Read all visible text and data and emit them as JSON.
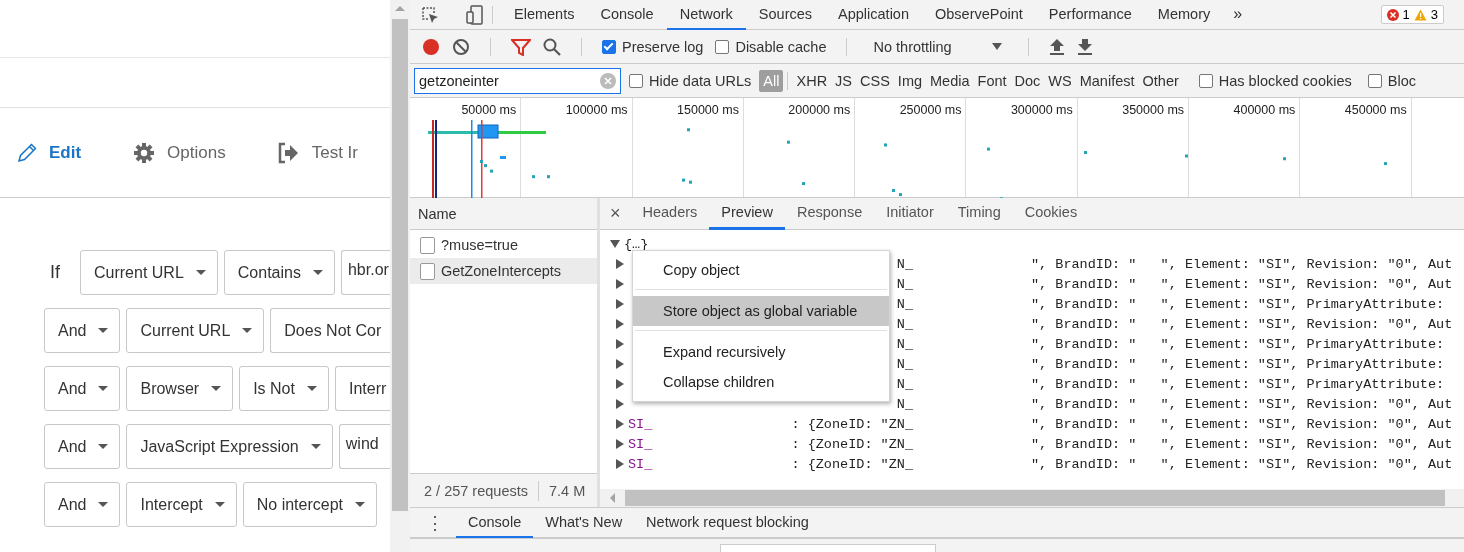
{
  "app": {
    "nav": [
      {
        "label": "Edit",
        "selected": true
      },
      {
        "label": "Options",
        "selected": false
      },
      {
        "label": "Test Ir",
        "selected": false
      }
    ],
    "rules": [
      {
        "lead": "If",
        "items": [
          {
            "label": "Current URL",
            "kind": "dropdown"
          },
          {
            "label": "Contains",
            "kind": "dropdown"
          },
          {
            "label": "hbr.or",
            "kind": "field",
            "cut": true
          }
        ]
      },
      {
        "items": [
          {
            "label": "And",
            "kind": "dropdown"
          },
          {
            "label": "Current URL",
            "kind": "dropdown"
          },
          {
            "label": "Does Not Cor",
            "kind": "dropdown",
            "cut": true
          }
        ]
      },
      {
        "items": [
          {
            "label": "And",
            "kind": "dropdown"
          },
          {
            "label": "Browser",
            "kind": "dropdown"
          },
          {
            "label": "Is Not",
            "kind": "dropdown"
          },
          {
            "label": "Interr",
            "kind": "dropdown",
            "cut": true
          }
        ]
      },
      {
        "items": [
          {
            "label": "And",
            "kind": "dropdown"
          },
          {
            "label": "JavaScript Expression",
            "kind": "dropdown"
          },
          {
            "label": "wind",
            "kind": "field",
            "cut": true
          }
        ]
      },
      {
        "items": [
          {
            "label": "And",
            "kind": "dropdown"
          },
          {
            "label": "Intercept",
            "kind": "dropdown"
          },
          {
            "label": "No intercept",
            "kind": "dropdown"
          }
        ]
      }
    ]
  },
  "devtools": {
    "tabs": [
      {
        "label": "Elements",
        "selected": false
      },
      {
        "label": "Console",
        "selected": false
      },
      {
        "label": "Network",
        "selected": true
      },
      {
        "label": "Sources",
        "selected": false
      },
      {
        "label": "Application",
        "selected": false
      },
      {
        "label": "ObservePoint",
        "selected": false
      },
      {
        "label": "Performance",
        "selected": false
      },
      {
        "label": "Memory",
        "selected": false
      }
    ],
    "more_tabs": "»",
    "errors": "1",
    "warnings": "3",
    "toolbar": {
      "recording": true,
      "checkboxes": [
        {
          "label": "Preserve log",
          "checked": true
        },
        {
          "label": "Disable cache",
          "checked": false
        }
      ],
      "throttling": "No throttling"
    },
    "filter": {
      "value": "getzoneinter",
      "hide_data_urls": {
        "label": "Hide data URLs",
        "checked": false
      },
      "types": [
        {
          "label": "All",
          "selected": true
        },
        {
          "label": "XHR",
          "selected": false
        },
        {
          "label": "JS",
          "selected": false
        },
        {
          "label": "CSS",
          "selected": false
        },
        {
          "label": "Img",
          "selected": false
        },
        {
          "label": "Media",
          "selected": false
        },
        {
          "label": "Font",
          "selected": false
        },
        {
          "label": "Doc",
          "selected": false
        },
        {
          "label": "WS",
          "selected": false
        },
        {
          "label": "Manifest",
          "selected": false
        },
        {
          "label": "Other",
          "selected": false
        }
      ],
      "extra_checkboxes": [
        {
          "label": "Has blocked cookies",
          "checked": false
        },
        {
          "label": "Bloc",
          "checked": false
        }
      ]
    },
    "overview_ticks": [
      "50000 ms",
      "100000 ms",
      "150000 ms",
      "200000 ms",
      "250000 ms",
      "300000 ms",
      "350000 ms",
      "400000 ms",
      "450000 ms"
    ],
    "requests": {
      "header": "Name",
      "rows": [
        {
          "name": "?muse=true",
          "selected": false
        },
        {
          "name": "GetZoneIntercepts",
          "selected": true
        }
      ],
      "count": "2 / 257 requests",
      "size": "7.4 M"
    },
    "detail": {
      "close": "×",
      "tabs": [
        {
          "label": "Headers",
          "selected": false
        },
        {
          "label": "Preview",
          "selected": true
        },
        {
          "label": "Response",
          "selected": false
        },
        {
          "label": "Initiator",
          "selected": false
        },
        {
          "label": "Timing",
          "selected": false
        },
        {
          "label": "Cookies",
          "selected": false
        }
      ],
      "root": {
        "label": "{…}",
        "expanded": true
      },
      "rows": [
        {
          "zone": "N_",
          "rest": "\", BrandID: \"   \", Element: \"SI\", Revision: \"0\", Aut"
        },
        {
          "zone": "N_",
          "rest": "\", BrandID: \"   \", Element: \"SI\", Revision: \"0\", Aut"
        },
        {
          "zone": "N_",
          "rest": "\", BrandID: \"   \", Element: \"SI\", PrimaryAttribute:"
        },
        {
          "zone": "N_",
          "rest": "\", BrandID: \"   \", Element: \"SI\", Revision: \"0\", Aut"
        },
        {
          "zone": "N_",
          "rest": "\", BrandID: \"   \", Element: \"SI\", PrimaryAttribute:"
        },
        {
          "zone": "N_",
          "rest": "\", BrandID: \"   \", Element: \"SI\", PrimaryAttribute:"
        },
        {
          "zone": "N_",
          "rest": "\", BrandID: \"   \", Element: \"SI\", PrimaryAttribute:"
        },
        {
          "zone": "N_",
          "rest": "\", BrandID: \"   \", Element: \"SI\", Revision: \"0\", Aut"
        },
        {
          "key": "SI_",
          "zone": ": {ZoneID: \"ZN_",
          "rest": "\", BrandID: \"   \", Element: \"SI\", Revision: \"0\", Aut"
        },
        {
          "key": "SI_",
          "zone": ": {ZoneID: \"ZN_",
          "rest": "\", BrandID: \"   \", Element: \"SI\", Revision: \"0\", Aut"
        },
        {
          "key": "SI_",
          "zone": ": {ZoneID: \"ZN_",
          "rest": "\", BrandID: \"   \", Element: \"SI\", Revision: \"0\", Aut"
        }
      ],
      "menu": [
        {
          "kind": "item",
          "label": "Copy object",
          "selected": false
        },
        {
          "kind": "separator"
        },
        {
          "kind": "item",
          "label": "Store object as global variable",
          "selected": true
        },
        {
          "kind": "separator"
        },
        {
          "kind": "item",
          "label": "Expand recursively",
          "selected": false
        },
        {
          "kind": "item",
          "label": "Collapse children",
          "selected": false
        }
      ]
    },
    "drawer": {
      "more": "⋮",
      "tabs": [
        {
          "label": "Console",
          "selected": true
        },
        {
          "label": "What's New",
          "selected": false
        },
        {
          "label": "Network request blocking",
          "selected": false
        }
      ]
    }
  }
}
